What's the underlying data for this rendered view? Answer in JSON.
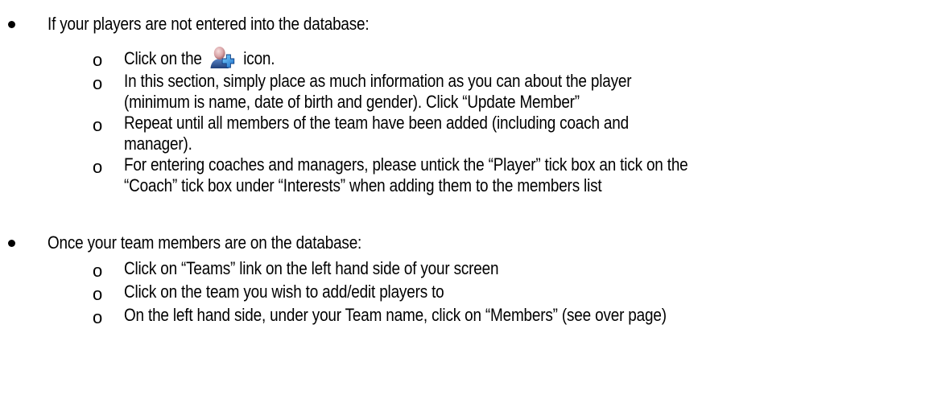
{
  "section1": {
    "heading": "If your players are not entered into the database:",
    "items": [
      {
        "pre": "Click on the ",
        "icon": "add-member-icon",
        "post": " icon."
      },
      {
        "line1": "In this section, simply place as much information as you can about the player",
        "line2": "(minimum is name, date of birth and gender). Click “Update Member”"
      },
      {
        "line1": "Repeat until all members of the team have been added (including coach and",
        "line2": "manager)."
      },
      {
        "line1": "For entering coaches and managers, please untick the “Player” tick box an tick on the",
        "line2": "“Coach” tick box under “Interests” when adding them to the members list"
      }
    ]
  },
  "section2": {
    "heading": "Once your team members are on the database:",
    "items": [
      "Click on “Teams” link on the left hand side of your screen",
      "Click on the team you wish to add/edit players to",
      "On the left hand side, under your Team name, click on “Members” (see over page)"
    ]
  },
  "markers": {
    "sub": "o"
  }
}
